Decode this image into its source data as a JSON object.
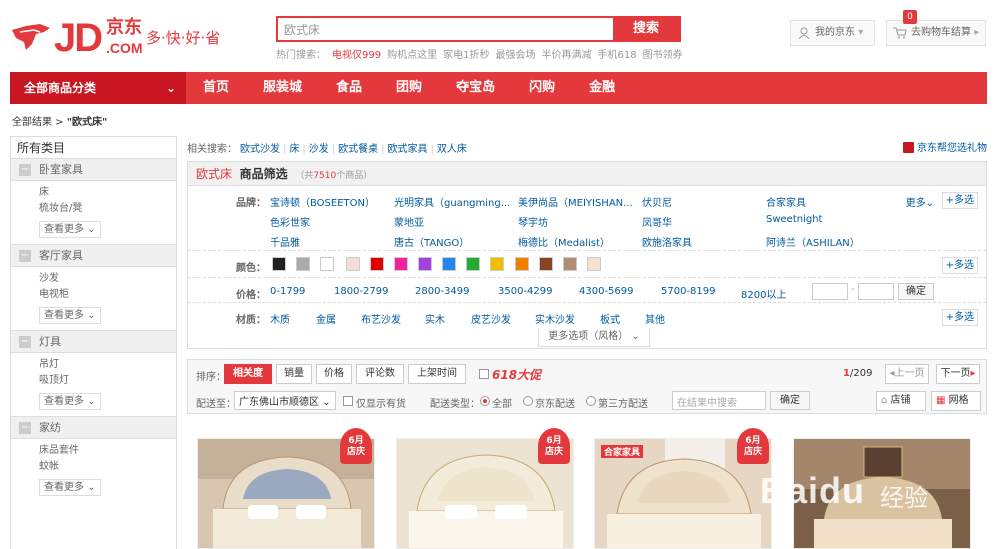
{
  "logo": {
    "text": "JD",
    "cn": "京东",
    "com": ".COM",
    "slogan": "多·快·好·省"
  },
  "search": {
    "value": "欧式床",
    "button": "搜索"
  },
  "hot_words": {
    "label": "热门搜索：",
    "items": [
      "电视仅999",
      "购机点这里",
      "家电1折秒",
      "最强会场",
      "半价再满减",
      "手机618",
      "图书领券"
    ]
  },
  "header": {
    "myjd": "我的京东",
    "cart": "去购物车结算",
    "cart_count": "0"
  },
  "nav": {
    "all": "全部商品分类",
    "items": [
      "首页",
      "服装城",
      "食品",
      "团购",
      "夺宝岛",
      "闪购",
      "金融"
    ]
  },
  "breadcrumb": {
    "root": "全部结果",
    "sep": " > ",
    "keyword": "\"欧式床\""
  },
  "sidebar": {
    "title": "所有类目",
    "more": "查看更多",
    "groups": [
      {
        "name": "卧室家具",
        "items": [
          "床",
          "梳妆台/凳"
        ]
      },
      {
        "name": "客厅家具",
        "items": [
          "沙发",
          "电视柜"
        ]
      },
      {
        "name": "灯具",
        "items": [
          "吊灯",
          "吸顶灯"
        ]
      },
      {
        "name": "家纺",
        "items": [
          "床品套件",
          "蚊帐"
        ]
      }
    ]
  },
  "related": {
    "label": "相关搜索：",
    "items": [
      "欧式沙发",
      "床",
      "沙发",
      "欧式餐桌",
      "欧式家具",
      "双人床"
    ]
  },
  "gift": "京东帮您选礼物",
  "filter": {
    "keyword": "欧式床",
    "title": "商品筛选",
    "count_prefix": "（共",
    "count": "7510",
    "count_suffix": "个商品）",
    "brand_label": "品牌：",
    "brands": [
      "宝诗顿（BOSEETON）",
      "光明家具（guangming...",
      "美伊尚品（MEIYISHAN...",
      "伏贝尼",
      "合家家具",
      "色彩世家",
      "蒙地亚",
      "琴宇坊",
      "凤哥华",
      "Sweetnight",
      "千品雅",
      "唐古（TANGO）",
      "梅德比（Medalist）",
      "欧施洛家具",
      "阿诗兰（ASHILAN）"
    ],
    "more": "更多",
    "multi": "+多选",
    "color_label": "颜色：",
    "colors": [
      "#222222",
      "#aaaaaa",
      "#ffffff",
      "#f8dcdc",
      "#e00000",
      "#ee2299",
      "#a044dd",
      "#2288ee",
      "#22aa33",
      "#f0c000",
      "#f08000",
      "#884422",
      "#b09070",
      "#f7e2cf"
    ],
    "price_label": "价格：",
    "prices": [
      "0-1799",
      "1800-2799",
      "2800-3499",
      "3500-4299",
      "4300-5699",
      "5700-8199",
      "8200以上"
    ],
    "price_ok": "确定",
    "material_label": "材质：",
    "materials": [
      "木质",
      "金属",
      "布艺沙发",
      "实木",
      "皮艺沙发",
      "实木沙发",
      "板式",
      "其他"
    ],
    "more_options": "更多选项（风格）"
  },
  "sort": {
    "label": "排序：",
    "items": [
      "相关度",
      "销量",
      "价格",
      "评论数",
      "上架时间"
    ],
    "promo": "618大促",
    "page": "1",
    "pages": "/209",
    "prev": "上一页",
    "next": "下一页",
    "ship_label": "配送至：",
    "ship_to": "广东佛山市顺德区",
    "instock": "仅显示有货",
    "type_label": "配送类型：",
    "types": [
      "全部",
      "京东配送",
      "第三方配送"
    ],
    "search_placeholder": "在结果中搜索",
    "search_ok": "确定",
    "shop": "店铺",
    "grid": "网格"
  },
  "products": {
    "badge_line1": "6月",
    "badge_line2": "店庆",
    "shop_logo": "合家家具"
  },
  "watermark": {
    "text": "Baidu",
    "cn": "经验"
  }
}
